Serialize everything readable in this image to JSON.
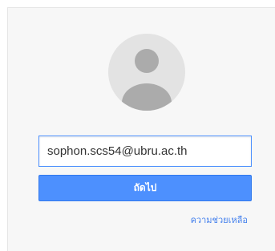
{
  "login": {
    "email_value": "sophon.scs54@ubru.ac.th",
    "next_label": "ถัดไป",
    "help_label": "ความช่วยเหลือ"
  },
  "colors": {
    "accent": "#4d90fe",
    "link": "#427fed",
    "card_bg": "#f7f7f7",
    "avatar_bg": "#e3e3e3",
    "avatar_figure": "#ababab"
  },
  "icons": {
    "avatar": "default-user-avatar-icon"
  }
}
